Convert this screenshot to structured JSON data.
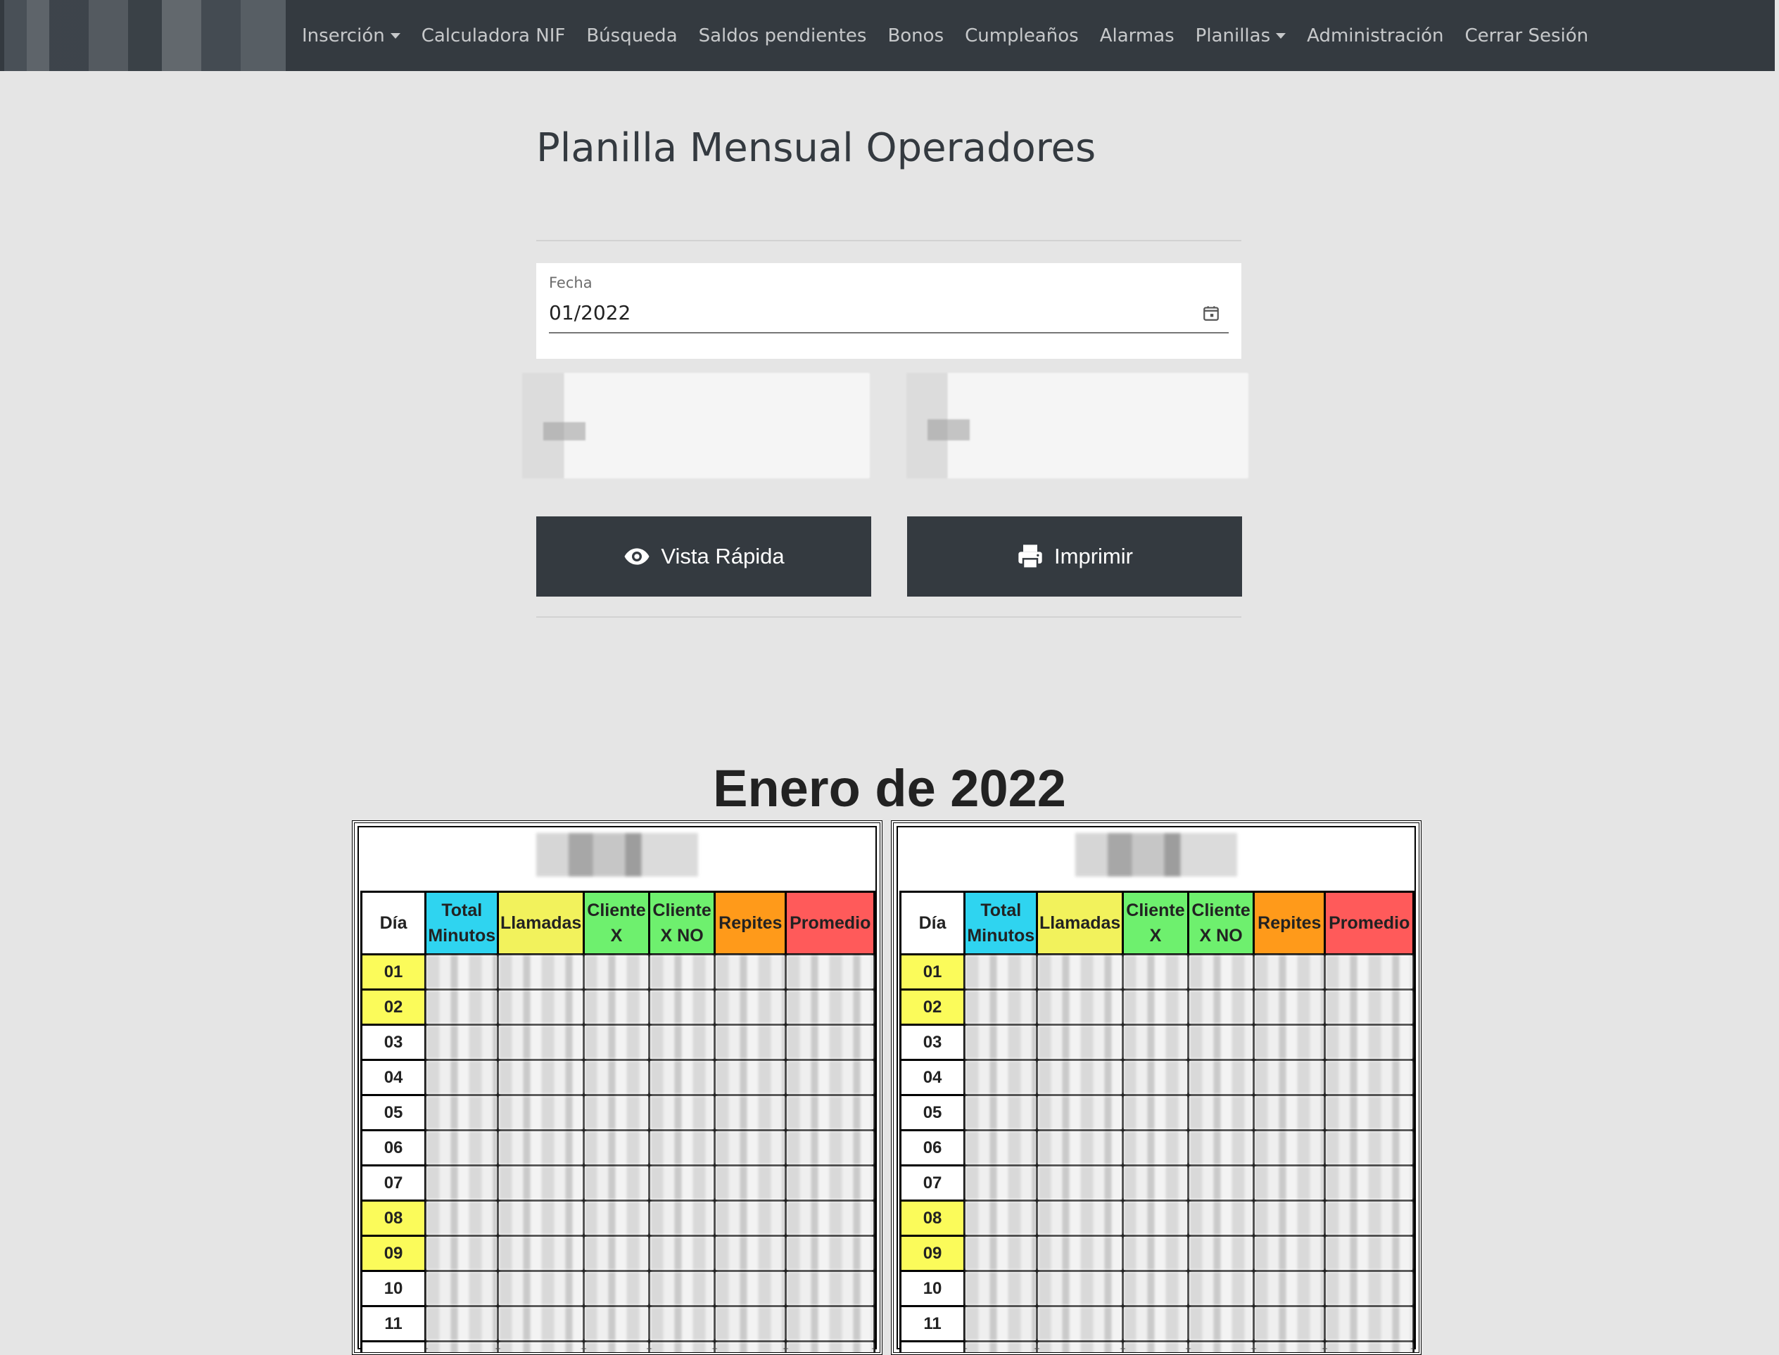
{
  "nav": {
    "items": [
      {
        "label": "Inserción",
        "dropdown": true
      },
      {
        "label": "Calculadora NIF",
        "dropdown": false
      },
      {
        "label": "Búsqueda",
        "dropdown": false
      },
      {
        "label": "Saldos pendientes",
        "dropdown": false
      },
      {
        "label": "Bonos",
        "dropdown": false
      },
      {
        "label": "Cumpleaños",
        "dropdown": false
      },
      {
        "label": "Alarmas",
        "dropdown": false
      },
      {
        "label": "Planillas",
        "dropdown": true
      },
      {
        "label": "Administración",
        "dropdown": false
      },
      {
        "label": "Cerrar Sesión",
        "dropdown": false
      }
    ]
  },
  "page": {
    "title": "Planilla Mensual Operadores"
  },
  "date_field": {
    "label": "Fecha",
    "value": "01/2022",
    "icon": "calendar-icon"
  },
  "buttons": {
    "quick_view": {
      "label": "Vista Rápida",
      "icon": "eye-icon"
    },
    "print": {
      "label": "Imprimir",
      "icon": "printer-icon"
    }
  },
  "report": {
    "title": "Enero de 2022",
    "columns": [
      {
        "label": "Día",
        "color": "#ffffff"
      },
      {
        "label": "Total Minutos",
        "color": "#2fd4f0"
      },
      {
        "label": "Llamadas",
        "color": "#f2f25c"
      },
      {
        "label": "Cliente X",
        "color": "#6ef06e"
      },
      {
        "label": "Cliente X NO",
        "color": "#6ef06e"
      },
      {
        "label": "Repites",
        "color": "#ff9a1a"
      },
      {
        "label": "Promedio",
        "color": "#ff5a5a"
      }
    ],
    "days": [
      {
        "day": "01",
        "highlight": true
      },
      {
        "day": "02",
        "highlight": true
      },
      {
        "day": "03",
        "highlight": false
      },
      {
        "day": "04",
        "highlight": false
      },
      {
        "day": "05",
        "highlight": false
      },
      {
        "day": "06",
        "highlight": false
      },
      {
        "day": "07",
        "highlight": false
      },
      {
        "day": "08",
        "highlight": true
      },
      {
        "day": "09",
        "highlight": true
      },
      {
        "day": "10",
        "highlight": false
      },
      {
        "day": "11",
        "highlight": false
      },
      {
        "day": "",
        "highlight": false
      }
    ],
    "day_highlight_color": "#fbfb5a",
    "operator_count": 2
  }
}
